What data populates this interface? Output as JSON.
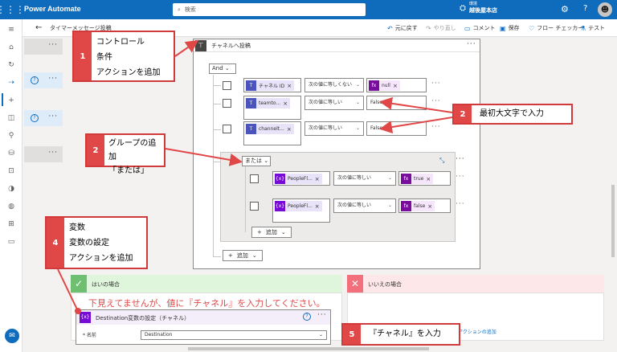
{
  "header": {
    "app_name": "Power Automate",
    "search_placeholder": "検索",
    "env_label": "環境",
    "env_name": "越後屋本店"
  },
  "commandbar": {
    "back_icon": "arrow-left-icon",
    "flow_name": "タイマーメッセージ投稿",
    "undo": "元に戻す",
    "redo": "やり直し",
    "comment": "コメント",
    "save": "保存",
    "checker": "フロー チェッカー",
    "test": "テスト"
  },
  "condition": {
    "title": "チャネルへ投稿",
    "and_label": "And",
    "rows": [
      {
        "token": "チャネル ID",
        "operator": "次の値に等しくない",
        "value_token": "null",
        "value_type": "fx"
      },
      {
        "token": "teamto...",
        "operator": "次の値に等しい",
        "value": "False"
      },
      {
        "token": "channelt...",
        "operator": "次の値に等しい",
        "value": "False"
      }
    ],
    "group": {
      "or_label": "または",
      "rows": [
        {
          "token": "PeopleFl...",
          "operator": "次の値に等しい",
          "value_token": "true"
        },
        {
          "token": "PeopleFl...",
          "operator": "次の値に等しい",
          "value_token": "false"
        }
      ],
      "add_label": "追加"
    },
    "add_label": "追加"
  },
  "yes_branch": {
    "label": "はいの場合"
  },
  "no_branch": {
    "label": "いいえの場合",
    "add_action": "アクションの追加"
  },
  "dest_card": {
    "title": "Destination変数の設定（チャネル）",
    "name_label": "* 名前",
    "name_value": "Destination"
  },
  "annotations": {
    "c1": {
      "num": "1",
      "lines": [
        "コントロール",
        "条件",
        "アクションを追加"
      ]
    },
    "c2a": {
      "num": "2",
      "lines": [
        "最初大文字で入力"
      ]
    },
    "c2b": {
      "num": "2",
      "lines": [
        "グループの追加",
        "「または」"
      ]
    },
    "c4": {
      "num": "4",
      "lines": [
        "変数",
        "変数の設定",
        "アクションを追加"
      ]
    },
    "c5": {
      "num": "5",
      "lines": [
        "『チャネル』を入力"
      ]
    },
    "red_note": "下見えてませんが、値に『チャネル』を入力してください。"
  },
  "colors": {
    "accent": "#0f6cbd",
    "annotation_red": "#e04848",
    "yes_green": "#6fbf73",
    "no_red": "#f1707b",
    "variable_purple": "#770bd6"
  }
}
